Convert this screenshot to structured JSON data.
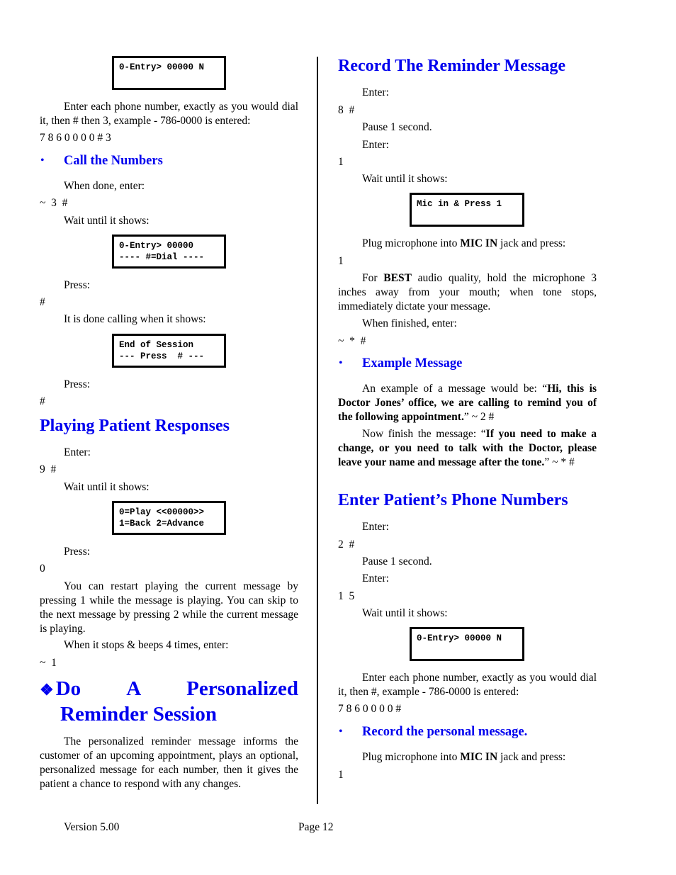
{
  "left_column": {
    "lcd_entry": {
      "line1": "0-Entry> 00000 N",
      "line2": ""
    },
    "entry_para": "Enter each phone number, exactly as you would dial it, then # then 3, example - 786-0000 is entered:",
    "entry_keys": "7 8 6 0 0 0 0 # 3",
    "call_heading": "Call the Numbers",
    "when_done": "When done, enter:",
    "when_done_keys": "~  3  #",
    "wait_shows_1": "Wait until it shows:",
    "lcd_dial": {
      "line1": "0-Entry> 00000",
      "line2": "---- #=Dial ----"
    },
    "press_1": "Press:",
    "press_1_keys": "#",
    "done_calling": "It is done calling when it shows:",
    "lcd_end": {
      "line1": "End of Session",
      "line2": "--- Press  # ---"
    },
    "press_2": "Press:",
    "press_2_keys": "#",
    "playing_heading": "Playing Patient Responses",
    "enter_1": "Enter:",
    "enter_1_keys": "9  #",
    "wait_shows_2": "Wait until it shows:",
    "lcd_play": {
      "line1": "0=Play <<00000>>",
      "line2": "1=Back 2=Advance"
    },
    "press_3": "Press:",
    "press_3_keys": "0",
    "restart_para": "You can restart playing the current message by pressing 1 while the message is playing.  You can skip to the next message by pressing 2 while the current message is playing.",
    "stops_beeps": "When it stops & beeps 4 times, enter:",
    "stops_keys": "~  1",
    "personalized_heading_line1": [
      "Do",
      "A",
      "Personalized"
    ],
    "personalized_heading_line2": "Reminder Session",
    "personalized_para": "The personalized reminder message informs the customer of an upcoming appointment, plays an optional, personalized message for each number, then it gives the patient a chance to respond with any changes."
  },
  "right_column": {
    "record_heading": "Record The Reminder Message",
    "enter_1": "Enter:",
    "enter_1_keys": "8  #",
    "pause_1": "Pause 1 second.",
    "enter_2": "Enter:",
    "enter_2_keys": "1",
    "wait_shows_1": "Wait until it shows:",
    "lcd_mic": {
      "line1": "Mic in & Press 1",
      "line2": ""
    },
    "plug_pre": "Plug microphone into ",
    "plug_bold": "MIC IN",
    "plug_post": " jack and press:",
    "plug_keys": "1",
    "best_pre": "For ",
    "best_bold": "BEST",
    "best_post": " audio quality, hold the microphone 3 inches away from your mouth; when tone stops, immediately dictate your message.",
    "when_finished": "When finished, enter:",
    "when_finished_keys": "~  *  #",
    "example_heading": "Example Message",
    "example_pre": "An example of a message would be:  “",
    "example_bold": "Hi, this is Doctor Jones’ office, we are calling to remind you of the following appointment.",
    "example_post": "” ~ 2  #",
    "finish_pre": "Now finish the message:  “",
    "finish_bold": "If you need to make a change, or you need to talk with the Doctor, please leave your name and message after the tone.",
    "finish_post": "” ~ * #",
    "phone_heading": "Enter Patient’s Phone Numbers",
    "enter_3": "Enter:",
    "enter_3_keys": "2  #",
    "pause_2": "Pause 1 second.",
    "enter_4": "Enter:",
    "enter_4_keys": "1  5",
    "wait_shows_2": "Wait until it shows:",
    "lcd_entry": {
      "line1": "0-Entry> 00000 N",
      "line2": ""
    },
    "entry_para": "Enter each phone number, exactly as you would dial it, then #, example - 786-0000 is entered:",
    "entry_keys": "7 8 6 0 0 0 0 #",
    "personal_heading": "Record the personal message.",
    "plug2_pre": "Plug microphone into ",
    "plug2_bold": "MIC IN",
    "plug2_post": " jack and press:",
    "plug2_keys": "1"
  },
  "footer": {
    "version": "Version 5.00",
    "page": "Page 12"
  },
  "icons": {
    "bullet": "•",
    "diamond_bullet": "❖"
  },
  "colors": {
    "heading": "#0000ee",
    "text": "#000000"
  }
}
